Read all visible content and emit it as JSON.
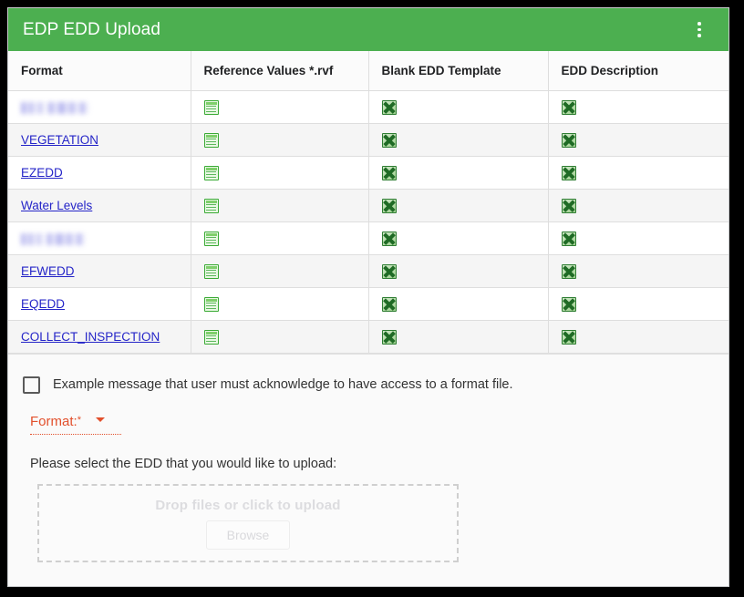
{
  "window": {
    "title": "EDP EDD Upload",
    "header_color": "#4caf50",
    "menu_icon": "kebab-menu-icon"
  },
  "table": {
    "columns": [
      "Format",
      "Reference Values *.rvf",
      "Blank EDD Template",
      "EDD Description"
    ],
    "rows": [
      {
        "format": "",
        "redacted": true,
        "reference_values": "spreadsheet-icon",
        "blank_template": "excel-icon",
        "description": "excel-icon"
      },
      {
        "format": "VEGETATION",
        "redacted": false,
        "reference_values": "spreadsheet-icon",
        "blank_template": "excel-icon",
        "description": "excel-icon"
      },
      {
        "format": "EZEDD",
        "redacted": false,
        "reference_values": "spreadsheet-icon",
        "blank_template": "excel-icon",
        "description": "excel-icon"
      },
      {
        "format": "Water Levels",
        "redacted": false,
        "reference_values": "spreadsheet-icon",
        "blank_template": "excel-icon",
        "description": "excel-icon"
      },
      {
        "format": "",
        "redacted": true,
        "reference_values": "spreadsheet-icon",
        "blank_template": "excel-icon",
        "description": "excel-icon"
      },
      {
        "format": "EFWEDD",
        "redacted": false,
        "reference_values": "spreadsheet-icon",
        "blank_template": "excel-icon",
        "description": "excel-icon"
      },
      {
        "format": "EQEDD",
        "redacted": false,
        "reference_values": "spreadsheet-icon",
        "blank_template": "excel-icon",
        "description": "excel-icon"
      },
      {
        "format": "COLLECT_INSPECTION",
        "redacted": false,
        "reference_values": "spreadsheet-icon",
        "blank_template": "excel-icon",
        "description": "excel-icon"
      }
    ]
  },
  "form": {
    "acknowledge_text": "Example message that user must acknowledge to have access to a format file.",
    "acknowledge_checked": false,
    "format_label": "Format:",
    "format_required_marker": "*",
    "format_value": "",
    "format_error_color": "#e2502c",
    "select_prompt": "Please select the EDD that you would like to upload:",
    "dropzone_text": "Drop files or click to upload",
    "browse_label": "Browse"
  }
}
